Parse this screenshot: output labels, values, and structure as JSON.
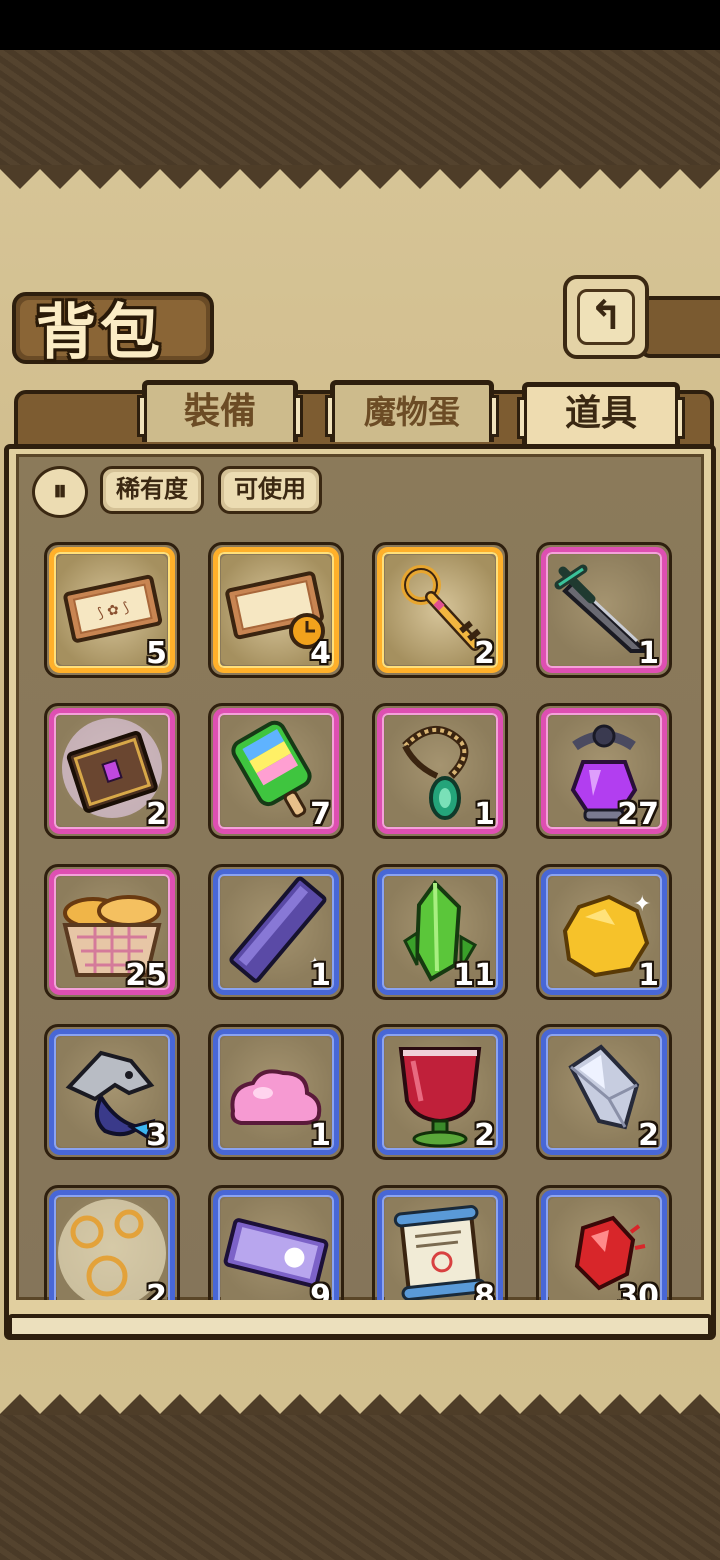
{
  "header": {
    "title": "背包",
    "back_icon": "return-arrow-icon"
  },
  "tabs": [
    {
      "label": "裝備",
      "active": false
    },
    {
      "label": "魔物蛋",
      "active": false
    },
    {
      "label": "道具",
      "active": true
    }
  ],
  "filters": {
    "sort_icon": "sort-toggle-icon",
    "sort_glyph": "⏸",
    "rarity_label": "稀有度",
    "usable_label": "可使用"
  },
  "colors": {
    "rarity_gold": "#ffb02a",
    "rarity_pink": "#de4fb2",
    "rarity_blue": "#4867d6"
  },
  "items": [
    {
      "icon": "gold-ticket-icon",
      "rarity": "gold",
      "count": "5"
    },
    {
      "icon": "timed-gold-ticket-icon",
      "rarity": "gold",
      "count": "4"
    },
    {
      "icon": "golden-key-icon",
      "rarity": "gold",
      "count": "2"
    },
    {
      "icon": "dark-sword-icon",
      "rarity": "pink",
      "count": "1"
    },
    {
      "icon": "glowing-spellbook-icon",
      "rarity": "pink",
      "count": "2"
    },
    {
      "icon": "rainbow-popsicle-icon",
      "rarity": "pink",
      "count": "7"
    },
    {
      "icon": "emerald-necklace-icon",
      "rarity": "pink",
      "count": "1"
    },
    {
      "icon": "purple-potion-icon",
      "rarity": "pink",
      "count": "27"
    },
    {
      "icon": "bread-basket-icon",
      "rarity": "pink",
      "count": "25"
    },
    {
      "icon": "purple-crystal-bar-icon",
      "rarity": "blue",
      "count": "1"
    },
    {
      "icon": "green-crystal-icon",
      "rarity": "blue",
      "count": "11"
    },
    {
      "icon": "gold-nugget-icon",
      "rarity": "blue",
      "count": "1"
    },
    {
      "icon": "monster-fish-icon",
      "rarity": "blue",
      "count": "3"
    },
    {
      "icon": "pink-slime-icon",
      "rarity": "blue",
      "count": "1"
    },
    {
      "icon": "red-wine-goblet-icon",
      "rarity": "blue",
      "count": "2"
    },
    {
      "icon": "silver-crystal-icon",
      "rarity": "blue",
      "count": "2"
    },
    {
      "icon": "golden-rings-icon",
      "rarity": "blue",
      "count": "2"
    },
    {
      "icon": "purple-ticket-icon",
      "rarity": "blue",
      "count": "9"
    },
    {
      "icon": "scroll-icon",
      "rarity": "blue",
      "count": "8"
    },
    {
      "icon": "red-gem-icon",
      "rarity": "blue",
      "count": "30"
    }
  ]
}
